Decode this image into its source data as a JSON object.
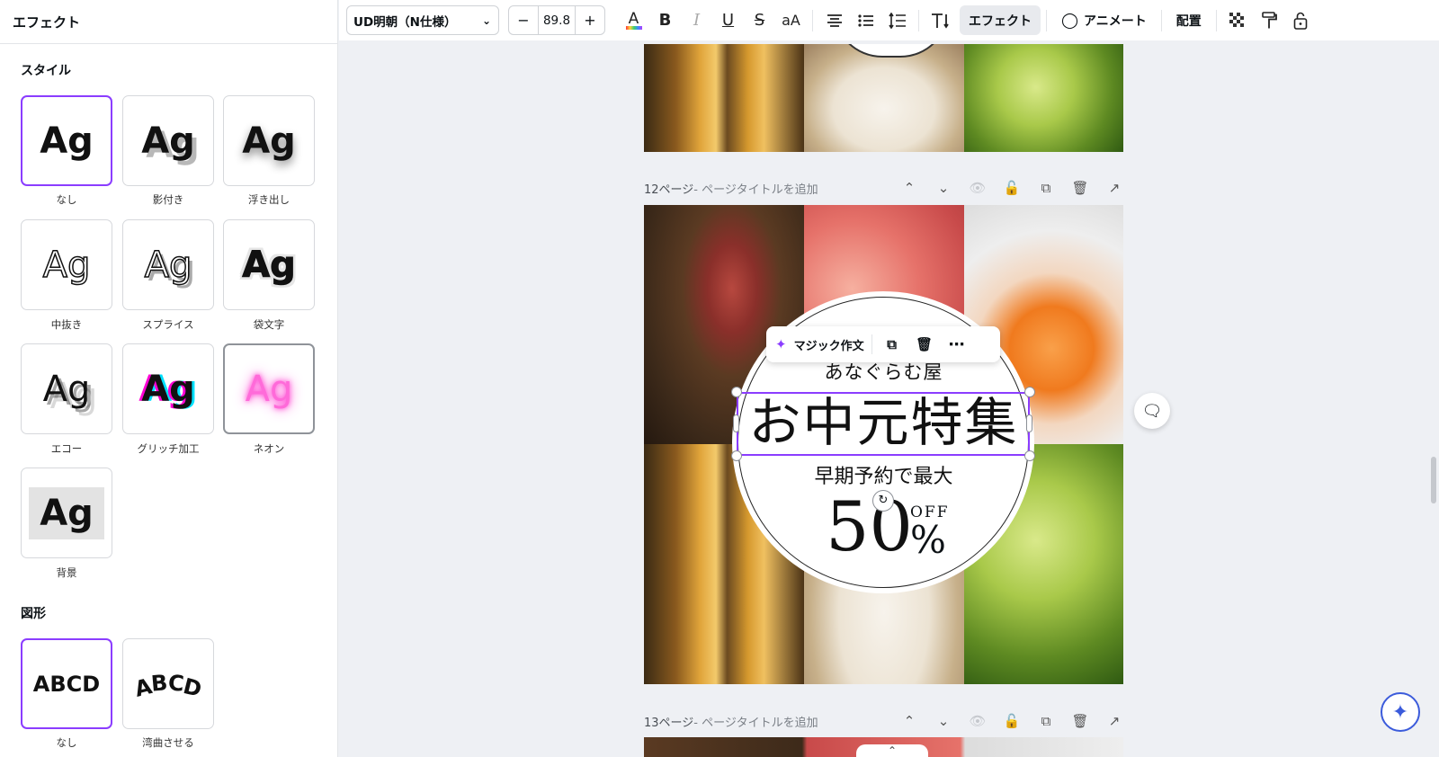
{
  "panel": {
    "title": "エフェクト",
    "styles_heading": "スタイル",
    "shapes_heading": "図形",
    "styles": [
      {
        "sample": "Ag",
        "label": "なし",
        "selected": true
      },
      {
        "sample": "Ag",
        "label": "影付き"
      },
      {
        "sample": "Ag",
        "label": "浮き出し"
      },
      {
        "sample": "Ag",
        "label": "中抜き"
      },
      {
        "sample": "Ag",
        "label": "スプライス"
      },
      {
        "sample": "Ag",
        "label": "袋文字"
      },
      {
        "sample": "Ag",
        "label": "エコー"
      },
      {
        "sample": "Ag",
        "label": "グリッチ加工"
      },
      {
        "sample": "Ag",
        "label": "ネオン"
      },
      {
        "sample": "Ag",
        "label": "背景"
      }
    ],
    "shapes": [
      {
        "sample": "ABCD",
        "label": "なし",
        "selected": true
      },
      {
        "sample": "ABCD",
        "label": "湾曲させる"
      }
    ]
  },
  "toolbar": {
    "font_name": "UD明朝（N仕様）",
    "font_size": "89.8",
    "minus": "−",
    "plus": "+",
    "bold": "B",
    "italic": "I",
    "underline": "U",
    "strike": "S",
    "case": "aA",
    "effect_label": "エフェクト",
    "animate_label": "アニメート",
    "position_label": "配置"
  },
  "canvas": {
    "page12": {
      "label": "12ページ",
      "title_placeholder": " - ページタイトルを追加"
    },
    "page13": {
      "label": "13ページ",
      "title_placeholder": " - ページタイトルを追加"
    },
    "design": {
      "shop_name": "あなぐらむ屋",
      "headline": "お中元特集",
      "subline": "早期予約で最大",
      "discount": "50",
      "off": "OFF",
      "percent": "%"
    },
    "float_bar": {
      "magic_write": "マジック作文"
    }
  },
  "colors": {
    "accent": "#8b3dff",
    "assistant": "#3b5bdb"
  }
}
